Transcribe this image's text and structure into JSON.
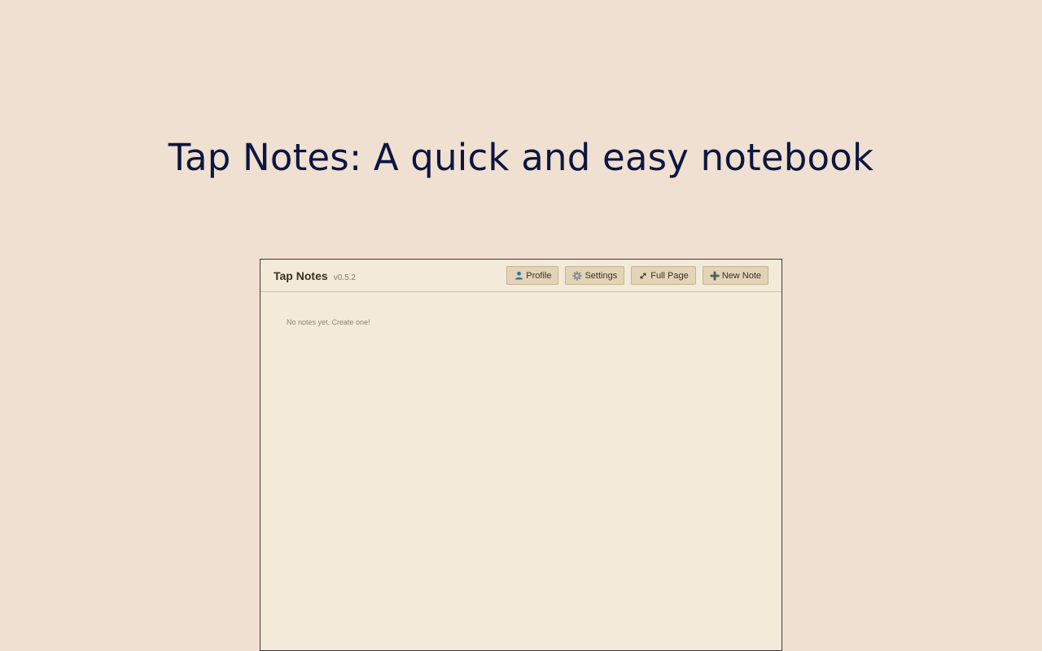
{
  "hero": {
    "title": "Tap Notes: A quick and easy notebook"
  },
  "app": {
    "name": "Tap Notes",
    "version": "v0.5.2",
    "toolbar": {
      "profile_label": "Profile",
      "profile_icon": "person-icon",
      "settings_label": "Settings",
      "settings_icon": "gear-icon",
      "fullpage_label": "Full Page",
      "fullpage_icon": "expand-icon",
      "newnote_label": "New Note",
      "newnote_icon": "plus-icon"
    },
    "empty_message": "No notes yet. Create one!"
  },
  "colors": {
    "page_background": "#efe0d1",
    "app_background": "#f3eada",
    "title_color": "#0c1640",
    "button_background": "#e3d4b8"
  }
}
